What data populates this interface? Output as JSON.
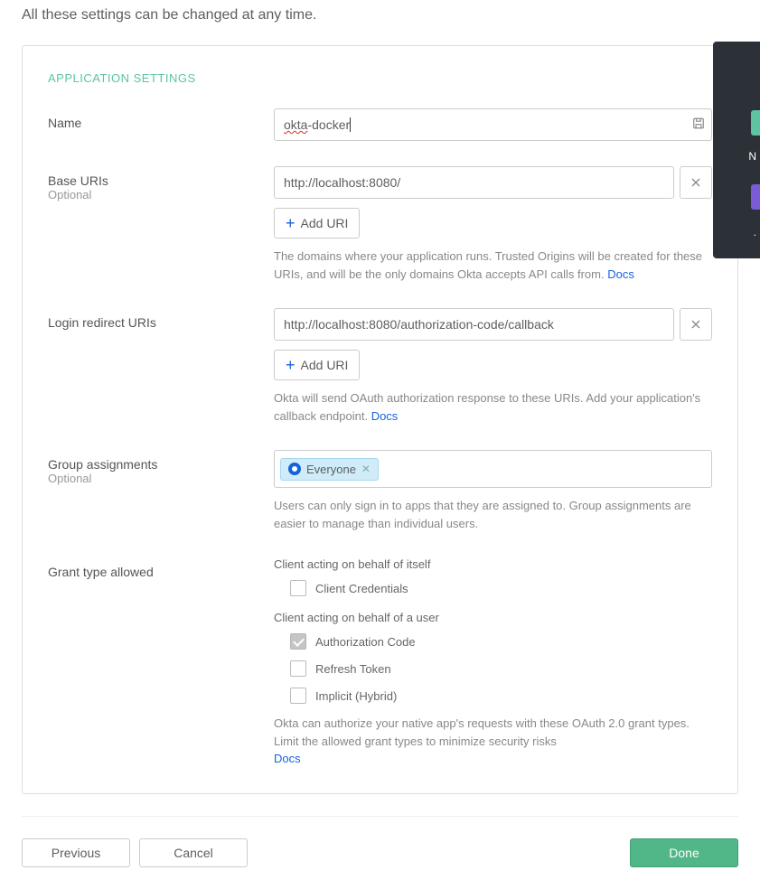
{
  "intro": "All these settings can be changed at any time.",
  "section_title": "APPLICATION SETTINGS",
  "name": {
    "label": "Name",
    "value_part1": "okta",
    "value_part2": "-docker"
  },
  "base_uris": {
    "label": "Base URIs",
    "sub": "Optional",
    "values": [
      "http://localhost:8080/"
    ],
    "add_label": "Add URI",
    "helper": "The domains where your application runs. Trusted Origins will be created for these URIs, and will be the only domains Okta accepts API calls from. ",
    "docs": "Docs"
  },
  "login_uris": {
    "label": "Login redirect URIs",
    "values": [
      "http://localhost:8080/authorization-code/callback"
    ],
    "add_label": "Add URI",
    "helper": "Okta will send OAuth authorization response to these URIs. Add your application's callback endpoint. ",
    "docs": "Docs"
  },
  "group": {
    "label": "Group assignments",
    "sub": "Optional",
    "tags": [
      "Everyone"
    ],
    "helper": "Users can only sign in to apps that they are assigned to. Group assignments are easier to manage than individual users."
  },
  "grant": {
    "label": "Grant type allowed",
    "self_heading": "Client acting on behalf of itself",
    "self_options": [
      {
        "label": "Client Credentials",
        "checked": false
      }
    ],
    "user_heading": "Client acting on behalf of a user",
    "user_options": [
      {
        "label": "Authorization Code",
        "checked": true
      },
      {
        "label": "Refresh Token",
        "checked": false
      },
      {
        "label": "Implicit (Hybrid)",
        "checked": false
      }
    ],
    "helper": "Okta can authorize your native app's requests with these OAuth 2.0 grant types. Limit the allowed grant types to minimize security risks ",
    "docs": "Docs"
  },
  "footer": {
    "previous": "Previous",
    "cancel": "Cancel",
    "done": "Done"
  },
  "side": {
    "text1": "N",
    "text2": "."
  }
}
